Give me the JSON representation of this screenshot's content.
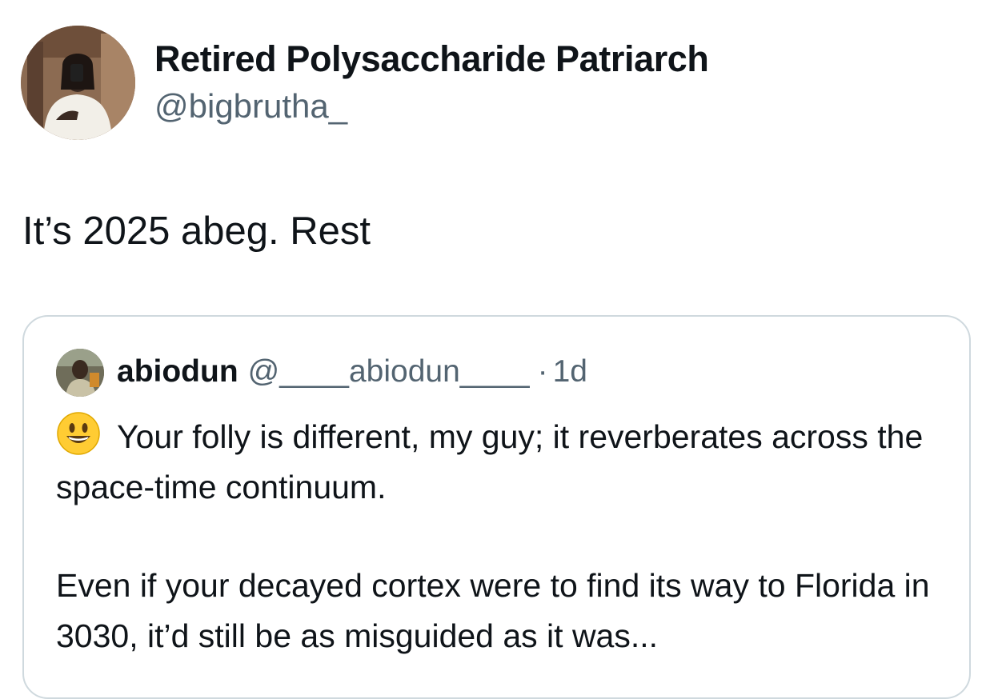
{
  "tweet": {
    "author": {
      "display_name": "Retired Polysaccharide Patriarch",
      "handle": "@bigbrutha_"
    },
    "text": "It’s 2025 abeg. Rest"
  },
  "quoted_tweet": {
    "author": {
      "display_name": "abiodun",
      "handle": "@____abiodun____"
    },
    "separator": "·",
    "time": "1d",
    "emoji_icon": "grinning-face-emoji",
    "paragraphs": [
      "Your folly is different, my guy; it reverberates across the space-time continuum.",
      "Even if your decayed cortex were to find its way to Florida in 3030, it’d still be as misguided as it was..."
    ]
  },
  "colors": {
    "text_primary": "#0f1419",
    "text_secondary": "#536471",
    "border": "#cfd9de"
  }
}
